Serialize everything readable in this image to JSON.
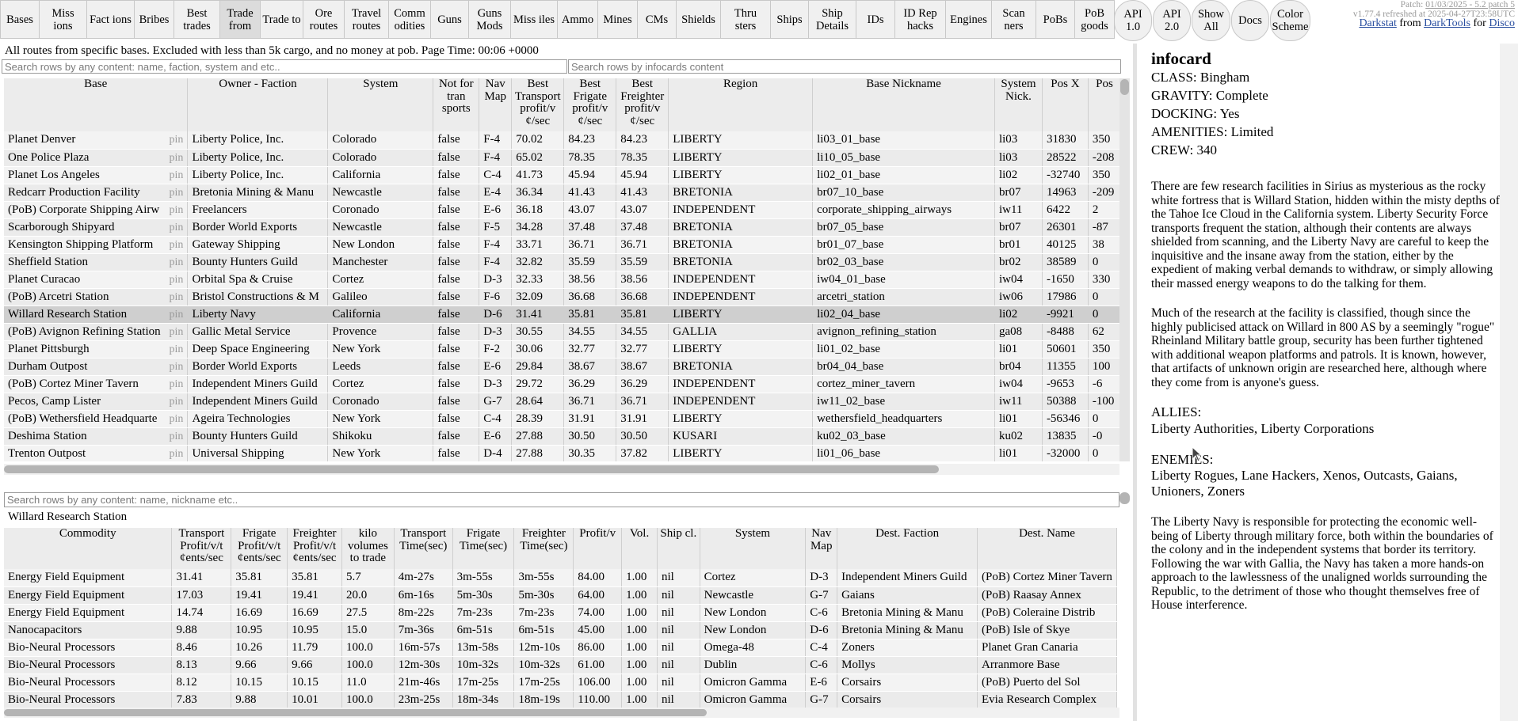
{
  "nav": [
    {
      "label": "Bases"
    },
    {
      "label": "Miss ions"
    },
    {
      "label": "Fact ions"
    },
    {
      "label": "Bribes"
    },
    {
      "label": "Best trades"
    },
    {
      "label": "Trade from",
      "active": true
    },
    {
      "label": "Trade to"
    },
    {
      "label": "Ore routes"
    },
    {
      "label": "Travel routes"
    },
    {
      "label": "Comm odities"
    },
    {
      "label": "Guns"
    },
    {
      "label": "Guns Mods"
    },
    {
      "label": "Miss iles"
    },
    {
      "label": "Ammo"
    },
    {
      "label": "Mines"
    },
    {
      "label": "CMs"
    },
    {
      "label": "Shields"
    },
    {
      "label": "Thru sters"
    },
    {
      "label": "Ships"
    },
    {
      "label": "Ship Details"
    },
    {
      "label": "IDs"
    },
    {
      "label": "ID Rep hacks"
    },
    {
      "label": "Engines"
    },
    {
      "label": "Scan ners"
    },
    {
      "label": "PoBs"
    },
    {
      "label": "PoB goods"
    },
    {
      "label": "API 1.0",
      "round": true
    },
    {
      "label": "API 2.0",
      "round": true
    },
    {
      "label": "Show All",
      "round": true
    },
    {
      "label": "Docs",
      "round": true
    },
    {
      "label": "Color Scheme",
      "round": true
    }
  ],
  "meta": {
    "patch_prefix": "Patch: ",
    "patch_link": "01/03/2025 - 5.2 patch 5",
    "version": "v1.77.4 refreshed at 2025-04-27T23:58UTC",
    "darkstat": "Darkstat",
    "from": " from ",
    "darktools": "DarkTools",
    "for": " for ",
    "disco": "Disco"
  },
  "summary": "All routes from specific bases. Excluded with less than 5k cargo, and no money at pob. Page Time: 00:06 +0000",
  "search": {
    "content_placeholder": "Search rows by any content: name, faction, system and etc..",
    "infocard_placeholder": "Search rows by infocards content",
    "commodity_placeholder": "Search rows by any content: name, nickname etc.."
  },
  "bases_table": {
    "headers": [
      "Base",
      "Owner - Faction",
      "System",
      "Not for tran sports",
      "Nav Map",
      "Best Transport profit/v ¢/sec",
      "Best Frigate profit/v ¢/sec",
      "Best Freighter profit/v ¢/sec",
      "Region",
      "Base Nickname",
      "System Nick.",
      "Pos X",
      "Pos"
    ],
    "pin": "pin",
    "rows": [
      [
        "Planet Denver",
        "Liberty Police, Inc.",
        "Colorado",
        "false",
        "F-4",
        "70.02",
        "84.23",
        "84.23",
        "LIBERTY",
        "li03_01_base",
        "li03",
        "31830",
        "350"
      ],
      [
        "One Police Plaza",
        "Liberty Police, Inc.",
        "Colorado",
        "false",
        "F-4",
        "65.02",
        "78.35",
        "78.35",
        "LIBERTY",
        "li10_05_base",
        "li03",
        "28522",
        "-208"
      ],
      [
        "Planet Los Angeles",
        "Liberty Police, Inc.",
        "California",
        "false",
        "C-4",
        "41.73",
        "45.94",
        "45.94",
        "LIBERTY",
        "li02_01_base",
        "li02",
        "-32740",
        "350"
      ],
      [
        "Redcarr Production Facility",
        "Bretonia Mining & Manu",
        "Newcastle",
        "false",
        "E-4",
        "36.34",
        "41.43",
        "41.43",
        "BRETONIA",
        "br07_10_base",
        "br07",
        "14963",
        "-209"
      ],
      [
        "(PoB) Corporate Shipping Airw",
        "Freelancers",
        "Coronado",
        "false",
        "E-6",
        "36.18",
        "43.07",
        "43.07",
        "INDEPENDENT",
        "corporate_shipping_airways",
        "iw11",
        "6422",
        "2"
      ],
      [
        "Scarborough Shipyard",
        "Border World Exports",
        "Newcastle",
        "false",
        "F-5",
        "34.28",
        "37.48",
        "37.48",
        "BRETONIA",
        "br07_05_base",
        "br07",
        "26301",
        "-87"
      ],
      [
        "Kensington Shipping Platform",
        "Gateway Shipping",
        "New London",
        "false",
        "F-4",
        "33.71",
        "36.71",
        "36.71",
        "BRETONIA",
        "br01_07_base",
        "br01",
        "40125",
        "38"
      ],
      [
        "Sheffield Station",
        "Bounty Hunters Guild",
        "Manchester",
        "false",
        "F-4",
        "32.82",
        "35.59",
        "35.59",
        "BRETONIA",
        "br02_03_base",
        "br02",
        "38589",
        "0"
      ],
      [
        "Planet Curacao",
        "Orbital Spa & Cruise",
        "Cortez",
        "false",
        "D-3",
        "32.33",
        "38.56",
        "38.56",
        "INDEPENDENT",
        "iw04_01_base",
        "iw04",
        "-1650",
        "330"
      ],
      [
        "(PoB) Arcetri Station",
        "Bristol Constructions & M",
        "Galileo",
        "false",
        "F-6",
        "32.09",
        "36.68",
        "36.68",
        "INDEPENDENT",
        "arcetri_station",
        "iw06",
        "17986",
        "0"
      ],
      [
        "Willard Research Station",
        "Liberty Navy",
        "California",
        "false",
        "D-6",
        "31.41",
        "35.81",
        "35.81",
        "LIBERTY",
        "li02_04_base",
        "li02",
        "-9921",
        "0"
      ],
      [
        "(PoB) Avignon Refining Station",
        "Gallic Metal Service",
        "Provence",
        "false",
        "D-3",
        "30.55",
        "34.55",
        "34.55",
        "GALLIA",
        "avignon_refining_station",
        "ga08",
        "-8488",
        "62"
      ],
      [
        "Planet Pittsburgh",
        "Deep Space Engineering",
        "New York",
        "false",
        "F-2",
        "30.06",
        "32.77",
        "32.77",
        "LIBERTY",
        "li01_02_base",
        "li01",
        "50601",
        "350"
      ],
      [
        "Durham Outpost",
        "Border World Exports",
        "Leeds",
        "false",
        "E-6",
        "29.84",
        "38.67",
        "38.67",
        "BRETONIA",
        "br04_04_base",
        "br04",
        "11355",
        "100"
      ],
      [
        "(PoB) Cortez Miner Tavern",
        "Independent Miners Guild",
        "Cortez",
        "false",
        "D-3",
        "29.72",
        "36.29",
        "36.29",
        "INDEPENDENT",
        "cortez_miner_tavern",
        "iw04",
        "-9653",
        "-6"
      ],
      [
        "Pecos, Camp Lister",
        "Independent Miners Guild",
        "Coronado",
        "false",
        "G-7",
        "28.64",
        "36.71",
        "36.71",
        "INDEPENDENT",
        "iw11_02_base",
        "iw11",
        "50388",
        "-100"
      ],
      [
        "(PoB) Wethersfield Headquarte",
        "Ageira Technologies",
        "New York",
        "false",
        "C-4",
        "28.39",
        "31.91",
        "31.91",
        "LIBERTY",
        "wethersfield_headquarters",
        "li01",
        "-56346",
        "0"
      ],
      [
        "Deshima Station",
        "Bounty Hunters Guild",
        "Shikoku",
        "false",
        "E-6",
        "27.88",
        "30.50",
        "30.50",
        "KUSARI",
        "ku02_03_base",
        "ku02",
        "13835",
        "-0"
      ],
      [
        "Trenton Outpost",
        "Universal Shipping",
        "New York",
        "false",
        "D-4",
        "27.88",
        "30.35",
        "37.82",
        "LIBERTY",
        "li01_06_base",
        "li01",
        "-32000",
        "0"
      ]
    ],
    "selected_row": 10
  },
  "selected_base": "Willard Research Station",
  "commodity_table": {
    "headers": [
      "Commodity",
      "Transport Profit/v/t ¢ents/sec",
      "Frigate Profit/v/t ¢ents/sec",
      "Freighter Profit/v/t ¢ents/sec",
      "kilo volumes to trade",
      "Transport Time(sec)",
      "Frigate Time(sec)",
      "Freighter Time(sec)",
      "Profit/v",
      "Vol.",
      "Ship cl.",
      "System",
      "Nav Map",
      "Dest. Faction",
      "Dest. Name"
    ],
    "rows": [
      [
        "Energy Field Equipment",
        "31.41",
        "35.81",
        "35.81",
        "5.7",
        "4m-27s",
        "3m-55s",
        "3m-55s",
        "84.00",
        "1.00",
        "nil",
        "Cortez",
        "D-3",
        "Independent Miners Guild",
        "(PoB) Cortez Miner Tavern"
      ],
      [
        "Energy Field Equipment",
        "17.03",
        "19.41",
        "19.41",
        "20.0",
        "6m-16s",
        "5m-30s",
        "5m-30s",
        "64.00",
        "1.00",
        "nil",
        "Newcastle",
        "G-7",
        "Gaians",
        "(PoB) Raasay Annex"
      ],
      [
        "Energy Field Equipment",
        "14.74",
        "16.69",
        "16.69",
        "27.5",
        "8m-22s",
        "7m-23s",
        "7m-23s",
        "74.00",
        "1.00",
        "nil",
        "New London",
        "C-6",
        "Bretonia Mining & Manu",
        "(PoB) Coleraine Distrib"
      ],
      [
        "Nanocapacitors",
        "9.88",
        "10.95",
        "10.95",
        "15.0",
        "7m-36s",
        "6m-51s",
        "6m-51s",
        "45.00",
        "1.00",
        "nil",
        "New London",
        "D-6",
        "Bretonia Mining & Manu",
        "(PoB) Isle of Skye"
      ],
      [
        "Bio-Neural Processors",
        "8.46",
        "10.26",
        "11.79",
        "100.0",
        "16m-57s",
        "13m-58s",
        "12m-10s",
        "86.00",
        "1.00",
        "nil",
        "Omega-48",
        "C-4",
        "Zoners",
        "Planet Gran Canaria"
      ],
      [
        "Bio-Neural Processors",
        "8.13",
        "9.66",
        "9.66",
        "100.0",
        "12m-30s",
        "10m-32s",
        "10m-32s",
        "61.00",
        "1.00",
        "nil",
        "Dublin",
        "C-6",
        "Mollys",
        "Arranmore Base"
      ],
      [
        "Bio-Neural Processors",
        "8.12",
        "10.15",
        "10.15",
        "11.0",
        "21m-46s",
        "17m-25s",
        "17m-25s",
        "106.00",
        "1.00",
        "nil",
        "Omicron Gamma",
        "E-6",
        "Corsairs",
        "(PoB) Puerto del Sol"
      ],
      [
        "Bio-Neural Processors",
        "7.83",
        "9.88",
        "10.01",
        "100.0",
        "23m-25s",
        "18m-34s",
        "18m-19s",
        "110.00",
        "1.00",
        "nil",
        "Omicron Gamma",
        "G-7",
        "Corsairs",
        "Evia Research Complex"
      ]
    ]
  },
  "infocard": {
    "title": "infocard",
    "stats": [
      "CLASS: Bingham",
      "GRAVITY: Complete",
      "DOCKING: Yes",
      "AMENITIES: Limited",
      "CREW: 340"
    ],
    "para1": "There are few research facilities in Sirius as mysterious as the rocky white fortress that is Willard Station, hidden within the misty depths of the Tahoe Ice Cloud in the California system. Liberty Security Force transports frequent the station, although their contents are always shielded from scanning, and the Liberty Navy are careful to keep the inquisitive and the insane away from the station, either by the expedient of making verbal demands to withdraw, or simply allowing their massed energy weapons to do the talking for them.",
    "para2": "Much of the research at the facility is classified, though since the highly publicised attack on Willard in 800 AS by a seemingly \"rogue\" Rheinland Military battle group, security has been further tightened with additional weapon platforms and patrols. It is known, however, that artifacts of unknown origin are researched here, although where they come from is anyone's guess.",
    "allies_label": "ALLIES:",
    "allies": "Liberty Authorities, Liberty Corporations",
    "enemies_label": "ENEMIES:",
    "enemies": "Liberty Rogues, Lane Hackers, Xenos, Outcasts, Gaians, Unioners, Zoners",
    "para3": "The Liberty Navy is responsible for protecting the economic well-being of Liberty through military force, both within the boundaries of the colony and in the independent systems that border its territory. Following the war with Gallia, the Navy has taken a more hands-on approach to the lawlessness of the unaligned worlds surrounding the Republic, to the detriment of those who thought themselves free of House interference."
  }
}
